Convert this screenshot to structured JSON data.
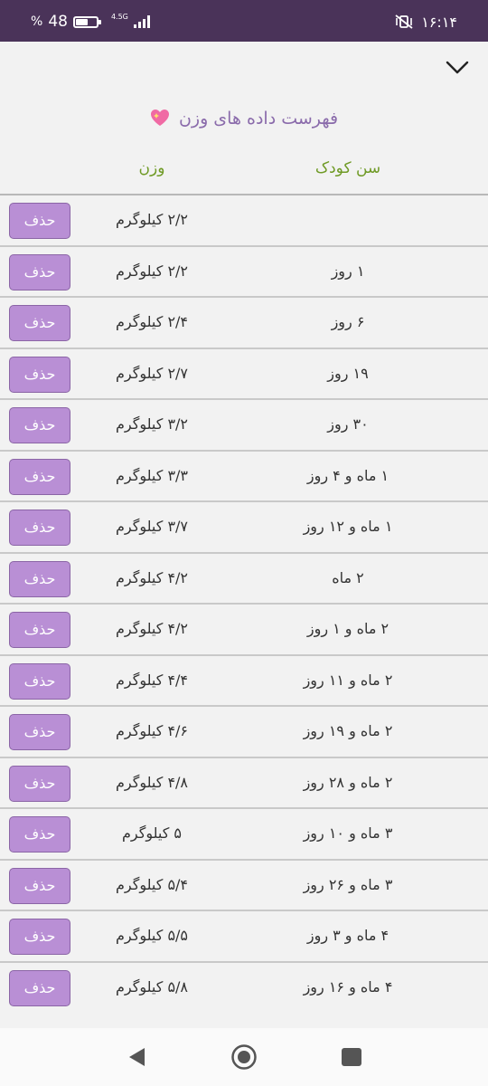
{
  "status_bar": {
    "battery_percent": "48",
    "percent_sign": "%",
    "network": "4.5G",
    "time": "۱۶:۱۴",
    "bg_color": "#4a3359"
  },
  "header": {
    "title": "فهرست داده های وزن",
    "title_icon": "sparkling-heart-icon",
    "col_age": "سن کودک",
    "col_weight": "وزن",
    "collapse_icon": "chevron-down-icon"
  },
  "delete_label": "حذف",
  "rows": [
    {
      "age": "",
      "weight": "۲/۲ کیلوگرم"
    },
    {
      "age": "۱ روز",
      "weight": "۲/۲ کیلوگرم"
    },
    {
      "age": "۶ روز",
      "weight": "۲/۴ کیلوگرم"
    },
    {
      "age": "۱۹ روز",
      "weight": "۲/۷ کیلوگرم"
    },
    {
      "age": "۳۰ روز",
      "weight": "۳/۲ کیلوگرم"
    },
    {
      "age": "۱ ماه و ۴ روز",
      "weight": "۳/۳ کیلوگرم"
    },
    {
      "age": "۱ ماه و ۱۲ روز",
      "weight": "۳/۷ کیلوگرم"
    },
    {
      "age": "۲ ماه",
      "weight": "۴/۲ کیلوگرم"
    },
    {
      "age": "۲ ماه و ۱ روز",
      "weight": "۴/۲ کیلوگرم"
    },
    {
      "age": "۲ ماه و ۱۱ روز",
      "weight": "۴/۴ کیلوگرم"
    },
    {
      "age": "۲ ماه و ۱۹ روز",
      "weight": "۴/۶ کیلوگرم"
    },
    {
      "age": "۲ ماه و ۲۸ روز",
      "weight": "۴/۸ کیلوگرم"
    },
    {
      "age": "۳ ماه و ۱۰ روز",
      "weight": "۵ کیلوگرم"
    },
    {
      "age": "۳ ماه و ۲۶ روز",
      "weight": "۵/۴ کیلوگرم"
    },
    {
      "age": "۴ ماه و ۳ روز",
      "weight": "۵/۵ کیلوگرم"
    },
    {
      "age": "۴ ماه و ۱۶ روز",
      "weight": "۵/۸ کیلوگرم"
    }
  ],
  "colors": {
    "accent_title": "#8a6bab",
    "header_green": "#6f9a25",
    "button_bg": "#b98fd5"
  },
  "nav": {
    "back_icon": "back-triangle-icon",
    "home_icon": "home-circle-icon",
    "recent_icon": "recent-apps-icon"
  }
}
